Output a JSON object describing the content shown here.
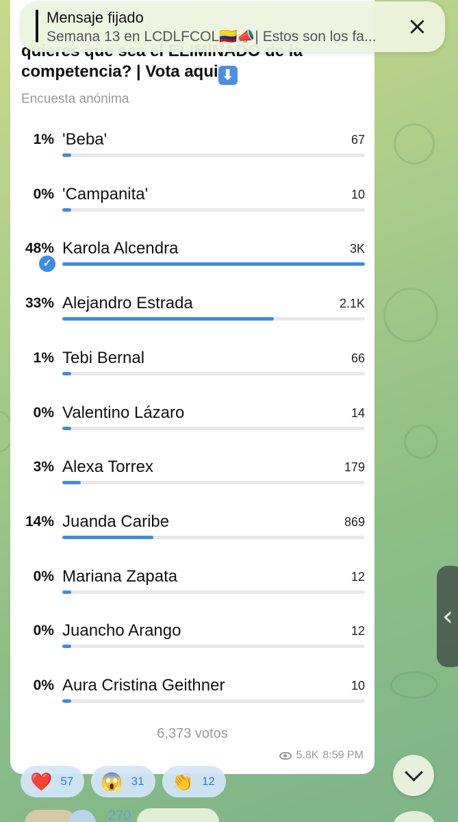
{
  "pinned": {
    "title": "Mensaje fijado",
    "text": "Semana 13 en LCDLFCOL🇨🇴📣| Estos son los fa..."
  },
  "poll": {
    "question_partial": "quieres que sea el ELIMINADO de la",
    "question": "competencia? | Vota aqui",
    "question_emoji": "⬇",
    "subtitle": "Encuesta anónima",
    "options": [
      {
        "pct": "1%",
        "name": "'Beba'",
        "count": "67",
        "fill": 0.01
      },
      {
        "pct": "0%",
        "name": "'Campanita'",
        "count": "10",
        "fill": 0.0
      },
      {
        "pct": "48%",
        "name": "Karola Alcendra",
        "count": "3K",
        "fill": 1.0,
        "voted": true
      },
      {
        "pct": "33%",
        "name": "Alejandro Estrada",
        "count": "2.1K",
        "fill": 0.7
      },
      {
        "pct": "1%",
        "name": "Tebi Bernal",
        "count": "66",
        "fill": 0.01
      },
      {
        "pct": "0%",
        "name": "Valentino Lázaro",
        "count": "14",
        "fill": 0.0
      },
      {
        "pct": "3%",
        "name": "Alexa Torrex",
        "count": "179",
        "fill": 0.06
      },
      {
        "pct": "14%",
        "name": "Juanda Caribe",
        "count": "869",
        "fill": 0.3
      },
      {
        "pct": "0%",
        "name": "Mariana Zapata",
        "count": "12",
        "fill": 0.0
      },
      {
        "pct": "0%",
        "name": "Juancho Arango",
        "count": "12",
        "fill": 0.0
      },
      {
        "pct": "0%",
        "name": "Aura Cristina Geithner",
        "count": "10",
        "fill": 0.0
      }
    ],
    "votes": "6,373 votos",
    "views": "5.8K",
    "time": "8:59 PM"
  },
  "reactions": [
    {
      "emoji": "❤️",
      "icon": "heart-icon",
      "count": "57"
    },
    {
      "emoji": "😱",
      "icon": "screaming-face-icon",
      "count": "31"
    },
    {
      "emoji": "👏",
      "icon": "clapping-hands-icon",
      "count": "12"
    }
  ],
  "bottom": {
    "count": "270"
  },
  "colors": {
    "accent": "#3b8be8",
    "bubble": "#ffffff",
    "muted": "#9a9a9a"
  }
}
